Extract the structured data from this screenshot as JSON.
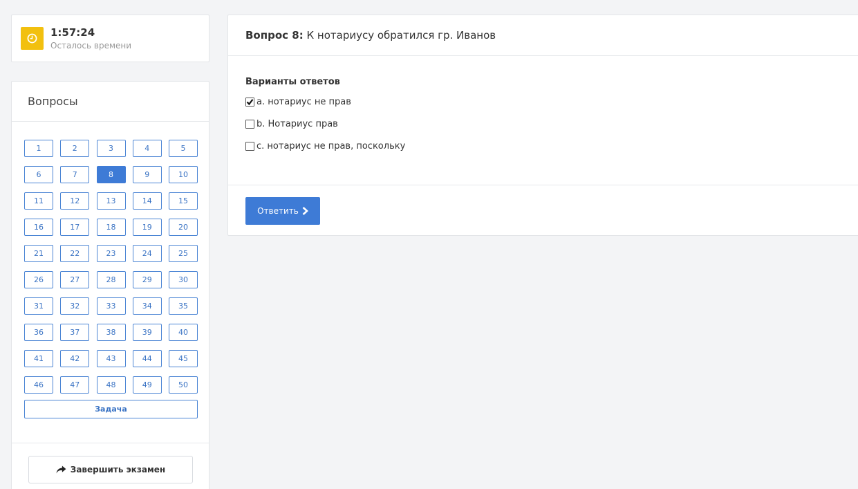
{
  "timer": {
    "value": "1:57:24",
    "label": "Осталось времени",
    "icon": "clock-icon",
    "accent": "#f2c00f"
  },
  "questions_panel": {
    "title": "Вопросы",
    "items": [
      "1",
      "2",
      "3",
      "4",
      "5",
      "6",
      "7",
      "8",
      "9",
      "10",
      "11",
      "12",
      "13",
      "14",
      "15",
      "16",
      "17",
      "18",
      "19",
      "20",
      "21",
      "22",
      "23",
      "24",
      "25",
      "26",
      "27",
      "28",
      "29",
      "30",
      "31",
      "32",
      "33",
      "34",
      "35",
      "36",
      "37",
      "38",
      "39",
      "40",
      "41",
      "42",
      "43",
      "44",
      "45",
      "46",
      "47",
      "48",
      "49",
      "50"
    ],
    "active": "8",
    "task_label": "Задача",
    "finish_label": "Завершить экзамен",
    "finish_icon": "share-arrow-icon"
  },
  "question": {
    "number_label": "Вопрос 8:",
    "text": "К нотариусу обратился гр. Иванов",
    "answers_title": "Варианты ответов",
    "options": [
      {
        "label": "a. нотариус не прав",
        "checked": true
      },
      {
        "label": "b. Нотариус прав",
        "checked": false
      },
      {
        "label": "c. нотариус не прав, поскольку",
        "checked": false
      }
    ],
    "submit_label": "Ответить",
    "submit_icon": "chevron-right-icon",
    "primary_color": "#3e7bd6"
  }
}
